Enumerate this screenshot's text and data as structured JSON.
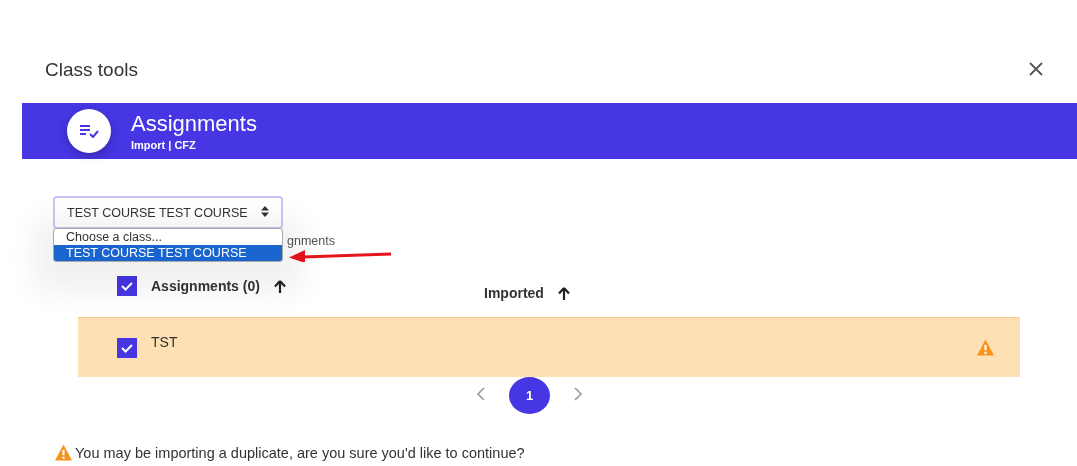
{
  "dialog": {
    "title": "Class tools"
  },
  "banner": {
    "title": "Assignments",
    "subtitle": "Import | CFZ"
  },
  "class_select": {
    "value": "TEST COURSE TEST COURSE",
    "expanded": true,
    "options": [
      {
        "label": "Choose a class...",
        "selected": false
      },
      {
        "label": "TEST COURSE TEST COURSE",
        "selected": true
      }
    ]
  },
  "covered_label": "gnments",
  "table": {
    "columns": [
      {
        "label": "Assignments (0)",
        "checked": true
      },
      {
        "label": "Imported"
      }
    ],
    "rows": [
      {
        "name": "TST",
        "checked": true,
        "duplicate": true
      }
    ]
  },
  "pagination": {
    "pages": [
      {
        "label": "1",
        "selected": true
      }
    ]
  },
  "warning": "You may be importing a duplicate, are you sure you'd like to continue?"
}
